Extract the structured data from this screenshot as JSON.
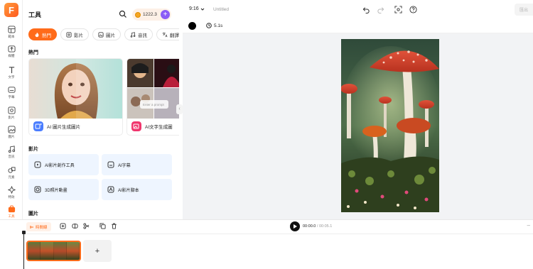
{
  "app": {
    "logo_letter": "F",
    "brand_color": "#ff6b1a"
  },
  "rail": {
    "items": [
      {
        "label": "範本",
        "icon": "template-icon"
      },
      {
        "label": "媒體",
        "icon": "upload-media-icon"
      },
      {
        "label": "文字",
        "icon": "text-icon"
      },
      {
        "label": "字幕",
        "icon": "subtitle-icon"
      },
      {
        "label": "影片",
        "icon": "video-icon"
      },
      {
        "label": "圖片",
        "icon": "image-icon"
      },
      {
        "label": "音訊",
        "icon": "audio-icon"
      },
      {
        "label": "元素",
        "icon": "elements-icon"
      },
      {
        "label": "特效",
        "icon": "effects-icon"
      },
      {
        "label": "工具",
        "icon": "tools-icon",
        "active": true
      }
    ]
  },
  "panel": {
    "title": "工具",
    "credits": "1222.3",
    "tabs": [
      {
        "label": "熱門",
        "active": true
      },
      {
        "label": "影片"
      },
      {
        "label": "圖片"
      },
      {
        "label": "音訊"
      },
      {
        "label": "翻譯"
      }
    ],
    "hot_label": "熱門",
    "cards": [
      {
        "label": "AI 圖片生成圖片",
        "prompt_hint": ""
      },
      {
        "label": "AI文字生成圖",
        "prompt_hint": "Enter a prompt"
      }
    ],
    "video_label": "影片",
    "video_tools": [
      {
        "label": "AI影片創作工具",
        "icon": "ai-video-icon"
      },
      {
        "label": "AI字幕",
        "icon": "ai-subtitle-icon"
      },
      {
        "label": "3D照片動畫",
        "icon": "3d-photo-icon"
      },
      {
        "label": "AI影片腳本",
        "icon": "ai-script-icon"
      }
    ],
    "image_label": "圖片"
  },
  "topbar": {
    "aspect_ratio": "9:16",
    "project_name": "Untitled",
    "export_label": "匯出"
  },
  "subbar": {
    "background_color": "#000000",
    "duration": "5.1s"
  },
  "timeline": {
    "mode_label": "時間線",
    "current_time": "00:00.0",
    "total_time": "00:05.1",
    "add_label": "+"
  }
}
